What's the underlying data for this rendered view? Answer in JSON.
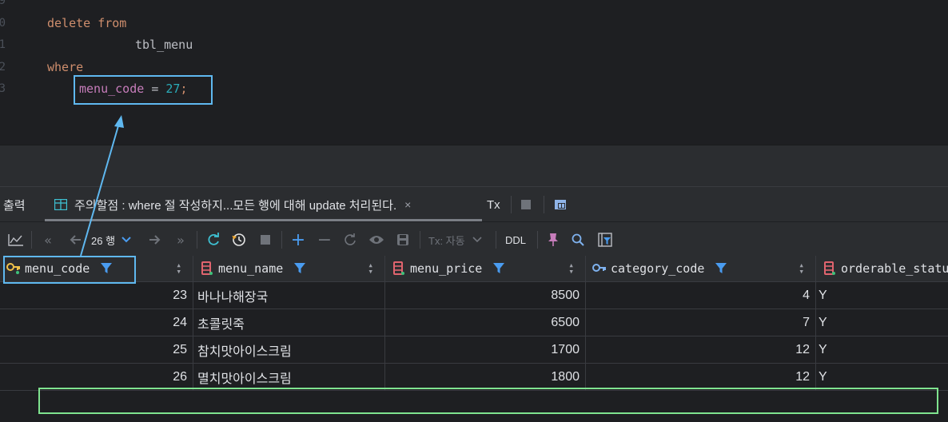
{
  "editor": {
    "line_numbers": [
      "9",
      "0",
      "1",
      "2",
      "3"
    ],
    "lines": [
      {
        "kw1": "delete",
        "kw2": "from"
      },
      {
        "table": "tbl_menu"
      },
      {
        "kw": "where"
      },
      {
        "column": "menu_code",
        "op": "=",
        "value": "27",
        "end": ";"
      }
    ]
  },
  "tabs": {
    "output": "출력",
    "result_title": "주의할점 :  where 절 작성하지...모든 행에 대해 update 처리된다.",
    "close": "×",
    "tx": "Tx"
  },
  "toolbar": {
    "row_count": "26 행",
    "tx_mode": "Tx: 자동",
    "ddl": "DDL"
  },
  "grid": {
    "columns": [
      {
        "name": "menu_code",
        "icon": "primary-key-icon"
      },
      {
        "name": "menu_name",
        "icon": "column-icon"
      },
      {
        "name": "menu_price",
        "icon": "column-icon"
      },
      {
        "name": "category_code",
        "icon": "foreign-key-icon"
      },
      {
        "name": "orderable_status",
        "icon": "column-icon"
      }
    ],
    "rows": [
      {
        "menu_code": "23",
        "menu_name": "바나나해장국",
        "menu_price": "8500",
        "category_code": "4",
        "orderable_status": "Y"
      },
      {
        "menu_code": "24",
        "menu_name": "초콜릿죽",
        "menu_price": "6500",
        "category_code": "7",
        "orderable_status": "Y"
      },
      {
        "menu_code": "25",
        "menu_name": "참치맛아이스크림",
        "menu_price": "1700",
        "category_code": "12",
        "orderable_status": "Y"
      },
      {
        "menu_code": "26",
        "menu_name": "멸치맛아이스크림",
        "menu_price": "1800",
        "category_code": "12",
        "orderable_status": "Y"
      }
    ]
  },
  "colors": {
    "highlight_blue": "#5fb8f0",
    "highlight_green": "#7fe38f",
    "filter_blue": "#4a9cf0"
  }
}
